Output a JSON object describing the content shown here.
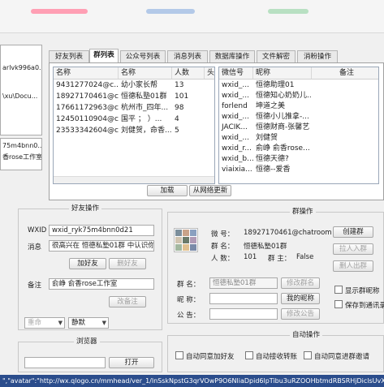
{
  "window": {
    "blur_colors": [
      "#ff7a9a",
      "#7fa7d9",
      "#8fd19e"
    ]
  },
  "left_list": [
    "arlvk996a0...",
    "\\xu\\Docu...",
    "75m4bnn0...",
    "香rose工作室"
  ],
  "tabs": [
    "好友列表",
    "群列表",
    "公众号列表",
    "消息列表",
    "数据库操作",
    "文件解密",
    "消粉操作"
  ],
  "group_grid": {
    "headers": [
      "名称",
      "名称",
      "人数",
      "头"
    ],
    "rows": [
      [
        "9431277024@c...",
        "幼小家长帮",
        "13",
        ""
      ],
      [
        "18927170461@c...",
        "恒德私塾01群",
        "101",
        ""
      ],
      [
        "17661172963@c...",
        "杭州市_四年...",
        "98",
        ""
      ],
      [
        "12450110904@c...",
        "国平 ； ）...",
        "4",
        ""
      ],
      [
        "23533342604@c...",
        "刘健贺，命香...",
        "5",
        ""
      ]
    ]
  },
  "member_grid": {
    "headers": [
      "微信号",
      "昵称",
      "备注"
    ],
    "rows": [
      [
        "wxid_...",
        "恒德助理01",
        ""
      ],
      [
        "wxid_...",
        "恒德知心奶奶儿...",
        ""
      ],
      [
        "forlend",
        "坤道之美",
        ""
      ],
      [
        "wxid_...",
        "恒德小儿推拿-...",
        ""
      ],
      [
        "JACIK...",
        "恒德财商-张馨艺",
        ""
      ],
      [
        "wxid_...",
        "刘健贺",
        ""
      ],
      [
        "wxid_r...",
        "俞峥 俞香rose...",
        ""
      ],
      [
        "wxid_b...",
        "恒德天德?",
        ""
      ],
      [
        "viaixia...",
        "恒德--爱香",
        ""
      ]
    ]
  },
  "load_btn": "加载",
  "net_update_btn": "从网络更新",
  "friend_ops": {
    "title": "好友操作",
    "wxid_label": "WXID",
    "wxid_value": "wxid_ryk75m4bnn0d21",
    "msg_label": "消息",
    "msg_value": "很高兴在 恒德私塾01群 中认识你",
    "add_friend": "加好友",
    "delete_friend": "删好友",
    "remark_label": "备注",
    "remark_value": "俞峥 俞香rose工作室",
    "edit_remark": "改备注",
    "select1": "重命",
    "select2": "静默"
  },
  "group_ops": {
    "title": "群操作",
    "wxid_label": "微 号：",
    "wxid_value": "18927170461@chatroom",
    "name_label": "群 名：",
    "name_value": "恒德私塾01群",
    "count_label": "人 数：",
    "count_value": "101",
    "owner_label": "群 主：",
    "owner_value": "False",
    "create": "创建群",
    "pull": "拉人入群",
    "kick": "删人出群",
    "rename_label": "群 名：",
    "rename_value": "恒德私塾01群",
    "rename_btn": "修改群名",
    "nick_label": "昵 称：",
    "nick_btn": "我的昵称",
    "notice_label": "公 告：",
    "notice_btn": "修改公告",
    "show_nick": "显示群昵称",
    "save_contacts": "保存到通讯录"
  },
  "browser": {
    "title": "浏览器",
    "open_btn": "打开"
  },
  "auto_ops": {
    "title": "自动操作",
    "items": [
      "自动同意加好友",
      "自动接收转账",
      "自动同意进群邀请"
    ]
  },
  "status_text": "\",\"avatar\":\"http://wx.qlogo.cn/mmhead/ver_1/lnSskNpstG3qrVOwP9O6NliaDpid6lpTibu3uRZOOHbtmdRBSRHjDiclsUvXm"
}
